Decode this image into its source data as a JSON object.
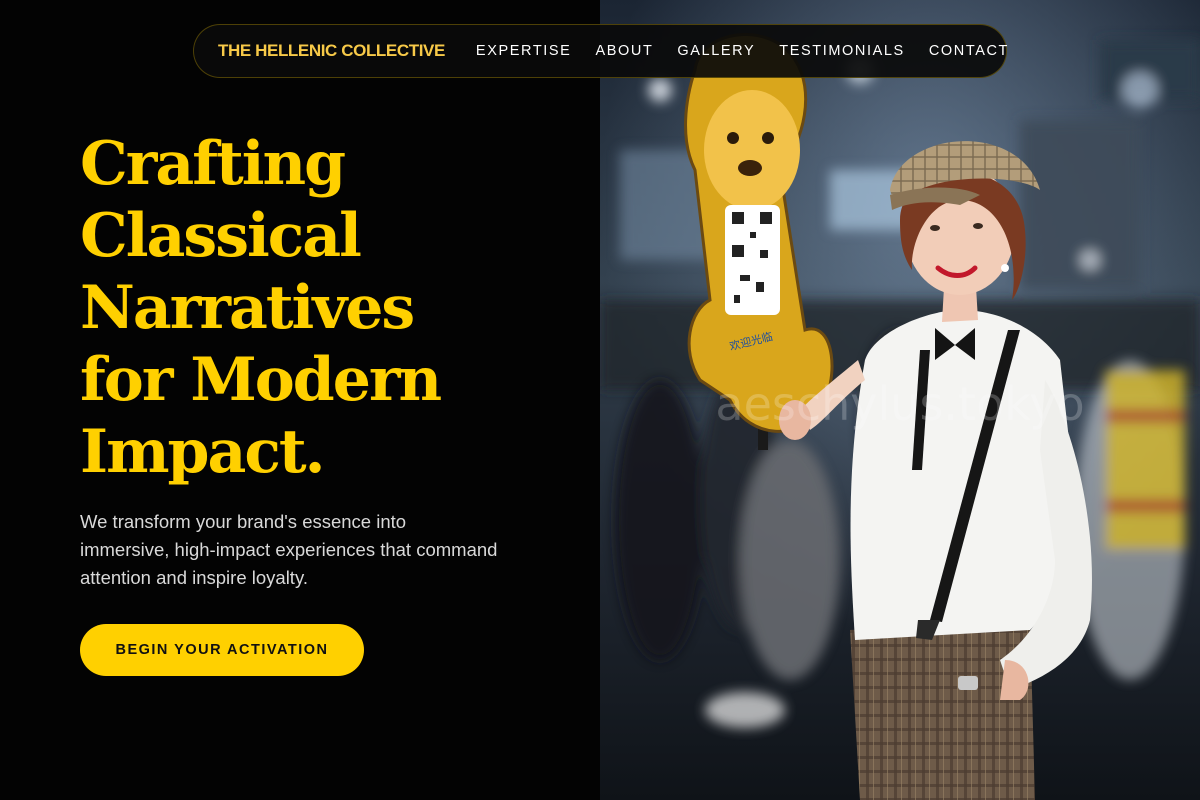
{
  "nav": {
    "brand": "THE HELLENIC COLLECTIVE",
    "links": [
      "EXPERTISE",
      "ABOUT",
      "GALLERY",
      "TESTIMONIALS",
      "CONTACT"
    ]
  },
  "hero": {
    "title_lines": [
      "Crafting",
      "Classical",
      "Narratives",
      "for Modern",
      "Impact."
    ],
    "subtitle": "We transform your brand's essence into immersive, high-impact experiences that command attention and inspire loyalty.",
    "cta_label": "BEGIN YOUR ACTIVATION"
  },
  "photo": {
    "watermark": "aeschylus.tokyo",
    "description_icon": "promotional-model-photo"
  },
  "colors": {
    "accent": "#ffd000",
    "brand": "#f7c948",
    "background": "#030303",
    "body_text": "#d9d9d9"
  }
}
